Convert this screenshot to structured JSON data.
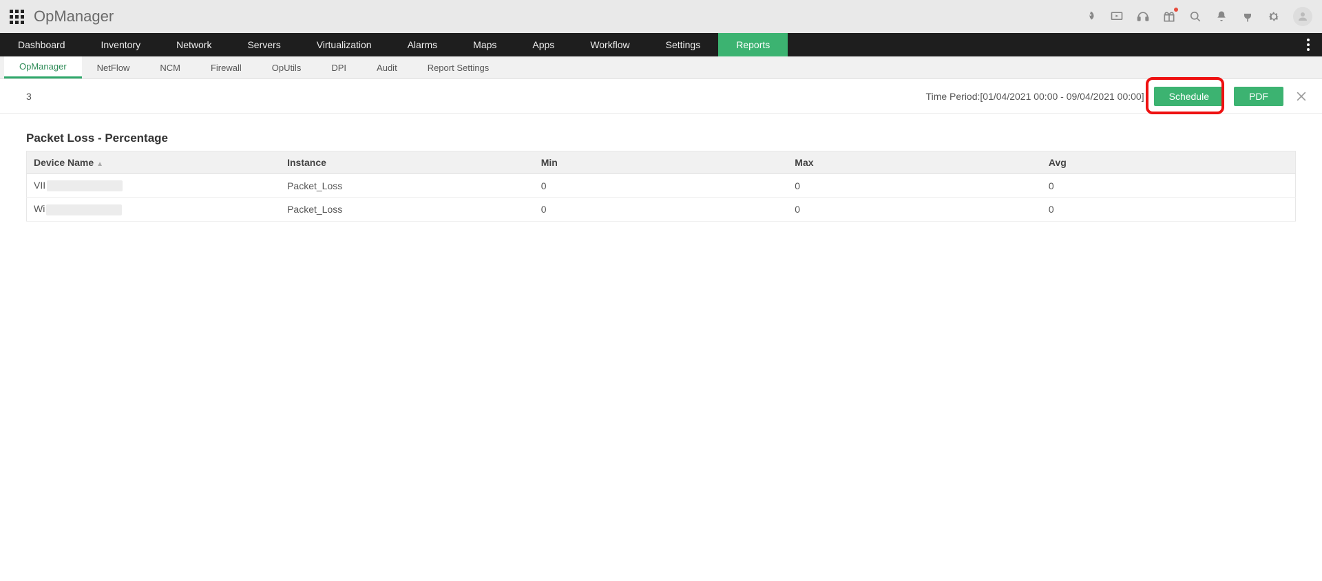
{
  "header": {
    "brand": "OpManager"
  },
  "nav": {
    "items": [
      "Dashboard",
      "Inventory",
      "Network",
      "Servers",
      "Virtualization",
      "Alarms",
      "Maps",
      "Apps",
      "Workflow",
      "Settings",
      "Reports"
    ],
    "activeIndex": 10
  },
  "subnav": {
    "items": [
      "OpManager",
      "NetFlow",
      "NCM",
      "Firewall",
      "OpUtils",
      "DPI",
      "Audit",
      "Report Settings"
    ],
    "activeIndex": 0
  },
  "controls": {
    "left_count": "3",
    "time_period_label": "Time Period:",
    "time_period_value": "[01/04/2021 00:00 - 09/04/2021 00:00]",
    "schedule_label": "Schedule",
    "pdf_label": "PDF"
  },
  "report": {
    "title": "Packet Loss - Percentage",
    "columns": [
      "Device Name",
      "Instance",
      "Min",
      "Max",
      "Avg"
    ],
    "rows": [
      {
        "device_prefix": "VII",
        "instance": "Packet_Loss",
        "min": "0",
        "max": "0",
        "avg": "0"
      },
      {
        "device_prefix": "Wi",
        "instance": "Packet_Loss",
        "min": "0",
        "max": "0",
        "avg": "0"
      }
    ]
  }
}
